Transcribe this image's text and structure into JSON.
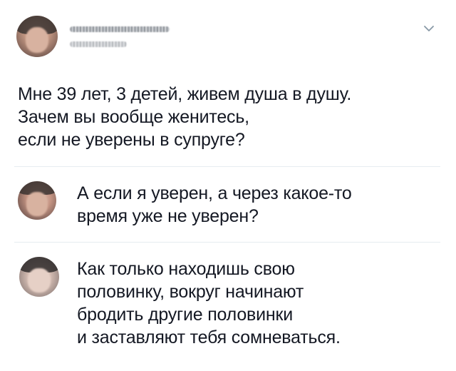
{
  "tweet": {
    "lines": [
      "Мне 39 лет, 3 детей, живем душа в душу.",
      "Зачем вы вообще женитесь,",
      "если не уверены в супруге?"
    ],
    "more_icon": "chevron-down-icon"
  },
  "replies": [
    {
      "lines": [
        "А если я уверен, а через какое-то",
        "время уже не уверен?"
      ]
    },
    {
      "lines": [
        "Как только находишь свою",
        "половинку, вокруг начинают",
        "бродить другие половинки",
        "и заставляют тебя сомневаться."
      ]
    }
  ],
  "colors": {
    "text": "#141823",
    "divider": "#e6ecf0",
    "chevron": "#8899a6"
  }
}
